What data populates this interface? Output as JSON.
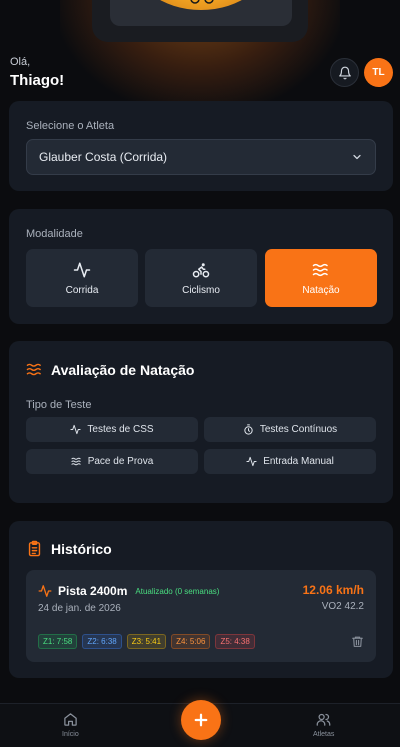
{
  "greeting": {
    "hello": "Olá,",
    "name": "Thiago!"
  },
  "header": {
    "avatar_initials": "TL",
    "notification_icon": "bell-icon"
  },
  "athlete": {
    "label": "Selecione o Atleta",
    "selected": "Glauber Costa (Corrida)"
  },
  "modality": {
    "label": "Modalidade",
    "options": [
      {
        "label": "Corrida",
        "icon": "activity-icon",
        "active": false
      },
      {
        "label": "Ciclismo",
        "icon": "bike-icon",
        "active": false
      },
      {
        "label": "Natação",
        "icon": "waves-icon",
        "active": true
      }
    ]
  },
  "evaluation": {
    "title": "Avaliação de Natação",
    "test_type_label": "Tipo de Teste",
    "tests": [
      {
        "label": "Testes de CSS",
        "icon": "activity-icon"
      },
      {
        "label": "Testes Contínuos",
        "icon": "timer-icon"
      },
      {
        "label": "Pace de Prova",
        "icon": "waves-icon"
      },
      {
        "label": "Entrada Manual",
        "icon": "activity-icon"
      }
    ]
  },
  "history": {
    "title": "Histórico",
    "items": [
      {
        "name": "Pista 2400m",
        "updated": "Atualizado (0 semanas)",
        "date": "24 de jan. de 2026",
        "speed": "12.06 km/h",
        "vo2": "VO2 42.2",
        "zones": [
          {
            "label": "Z1: 7:58",
            "color": "#4ade80"
          },
          {
            "label": "Z2: 6:38",
            "color": "#60a5fa"
          },
          {
            "label": "Z3: 5:41",
            "color": "#facc15"
          },
          {
            "label": "Z4: 5:06",
            "color": "#fb923c"
          },
          {
            "label": "Z5: 4:38",
            "color": "#f87171"
          }
        ]
      }
    ]
  },
  "nav": {
    "home": "Início",
    "athletes": "Atletas"
  },
  "colors": {
    "accent": "#f97316",
    "card": "#161b24",
    "surface": "#232a35",
    "success": "#4ade80"
  }
}
